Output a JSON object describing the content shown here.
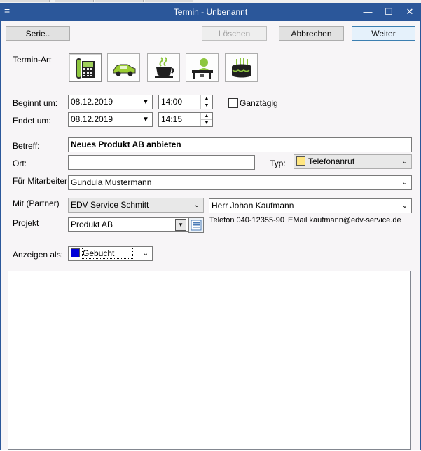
{
  "window": {
    "title": "Termin - Unbenannt",
    "system_menu_glyph": "=",
    "minimize_glyph": "—",
    "maximize_glyph": "☐",
    "close_glyph": "✕"
  },
  "toolbar": {
    "serie_label": "Serie..",
    "loeschen_label": "Löschen",
    "abbrechen_label": "Abbrechen",
    "weiter_label": "Weiter"
  },
  "termin_art": {
    "label": "Termin-Art",
    "buttons": [
      {
        "icon": "telephone-icon",
        "selected": true
      },
      {
        "icon": "car-icon",
        "selected": false
      },
      {
        "icon": "coffee-cup-icon",
        "selected": false
      },
      {
        "icon": "person-at-desk-icon",
        "selected": false
      },
      {
        "icon": "birthday-cake-icon",
        "selected": false
      }
    ]
  },
  "beginnt": {
    "label": "Beginnt um:",
    "date": "08.12.2019",
    "time": "14:00"
  },
  "endet": {
    "label": "Endet um:",
    "date": "08.12.2019",
    "time": "14:15"
  },
  "ganztaegig": {
    "label": "Ganztägig",
    "checked": false
  },
  "betreff": {
    "label": "Betreff:",
    "value": "Neues Produkt AB anbieten"
  },
  "ort": {
    "label": "Ort:",
    "value": ""
  },
  "typ": {
    "label": "Typ:",
    "value": "Telefonanruf",
    "color": "#ffe680"
  },
  "mitarbeiter": {
    "label": "Für Mitarbeiter",
    "value": "Gundula Mustermann"
  },
  "partner": {
    "label": "Mit (Partner)",
    "company": "EDV Service Schmitt",
    "contact": "Herr Johan Kaufmann",
    "telefon": "Telefon 040-12355-90",
    "email": "EMail kaufmann@edv-service.de"
  },
  "projekt": {
    "label": "Projekt",
    "value": "Produkt AB"
  },
  "anzeigen": {
    "label": "Anzeigen als:",
    "value": "Gebucht",
    "color": "#0000d8"
  },
  "notes": {
    "value": ""
  },
  "colors": {
    "titlebar": "#2b579a",
    "client_bg": "#f7f5f7"
  }
}
